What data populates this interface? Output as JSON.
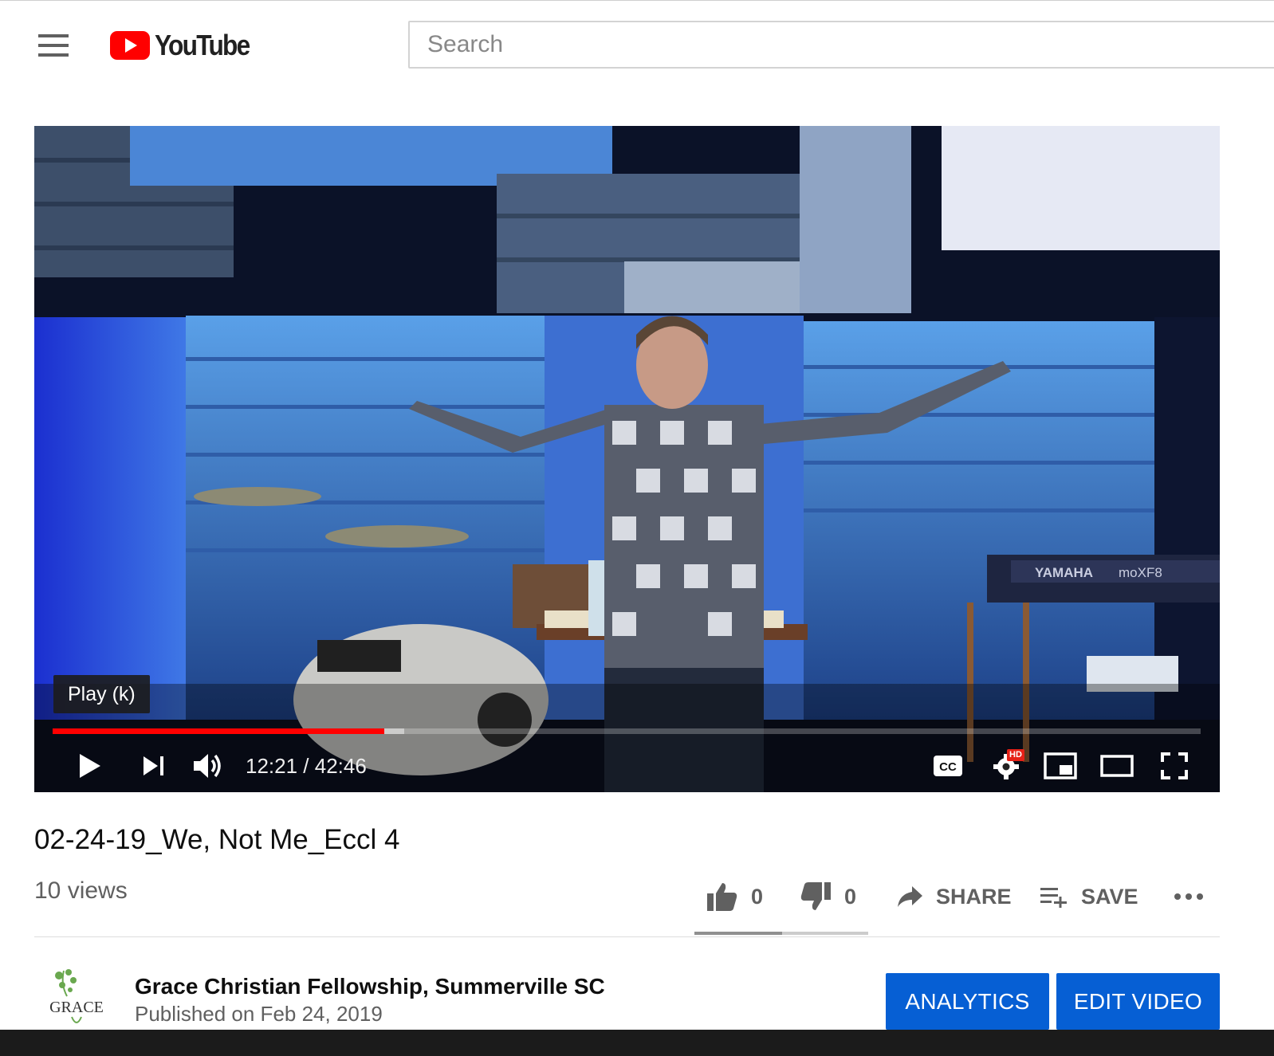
{
  "header": {
    "menu_icon": "hamburger-menu-icon",
    "logo_text": "YouTube",
    "search_placeholder": "Search"
  },
  "player": {
    "tooltip": "Play (k)",
    "current_time": "12:21",
    "separator": " / ",
    "duration": "42:46",
    "progress_fraction": 0.289,
    "buffered_fraction": 0.306,
    "hd_badge": "HD",
    "icons": [
      "play-icon",
      "next-icon",
      "volume-icon",
      "captions-icon",
      "settings-icon",
      "miniplayer-icon",
      "theater-mode-icon",
      "fullscreen-icon"
    ],
    "keyboard_brand": "YAMAHA",
    "keyboard_model": "moXF8"
  },
  "video": {
    "title": "02-24-19_We, Not Me_Eccl 4",
    "views": "10 views",
    "likes": "0",
    "dislikes": "0",
    "share_label": "SHARE",
    "save_label": "SAVE"
  },
  "channel": {
    "name": "Grace Christian Fellowship, Summerville SC",
    "published": "Published on Feb 24, 2019",
    "avatar_text": "GRACE",
    "analytics_label": "ANALYTICS",
    "edit_label": "EDIT VIDEO"
  },
  "colors": {
    "youtube_red": "#ff0000",
    "brand_blue": "#065fd4",
    "text_secondary": "#606060"
  }
}
